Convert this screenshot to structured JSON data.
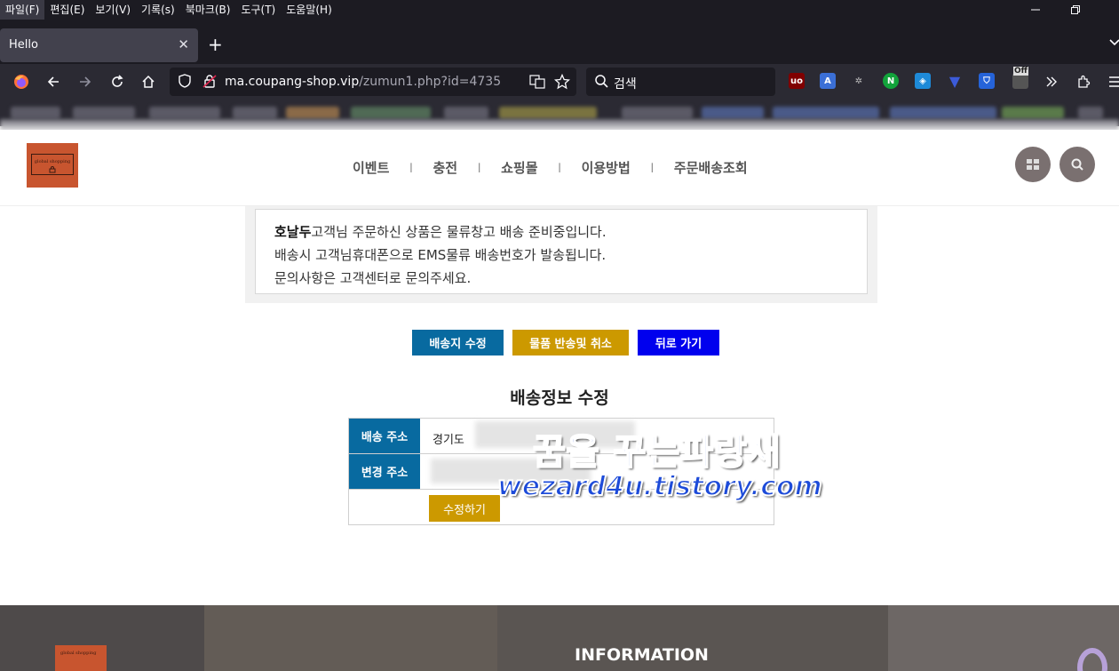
{
  "menubar": {
    "items": [
      "파일(F)",
      "편집(E)",
      "보기(V)",
      "기록(s)",
      "북마크(B)",
      "도구(T)",
      "도움말(H)"
    ]
  },
  "tab": {
    "title": "Hello",
    "close": "✕",
    "new_tab": "+"
  },
  "navbar": {
    "url_host": "ma.coupang-shop.vip",
    "url_path": "/zumun1.php?id=4735",
    "search_placeholder": "검색",
    "ext_off_badge": "Off"
  },
  "site": {
    "logo_text": "global shopping",
    "nav": [
      "이벤트",
      "충전",
      "쇼핑몰",
      "이용방법",
      "주문배송조회"
    ],
    "nav_separator": "ㅣ"
  },
  "notice": {
    "name": "호날두",
    "line1_rest": "고객님 주문하신 상품은 물류창고 배송 준비중입니다.",
    "line2": "배송시 고객님휴대폰으로 EMS물류 배송번호가 발송됩니다.",
    "line3": "문의사항은 고객센터로 문의주세요."
  },
  "buttons": {
    "edit_address": "배송지 수정",
    "return_cancel": "물품 반송및 취소",
    "back": "뒤로 가기"
  },
  "form": {
    "title": "배송정보 수정",
    "address_label": "배송 주소",
    "address_value": "경기도 ",
    "new_address_label": "변경 주소",
    "submit_label": "수정하기"
  },
  "watermark": {
    "line1": "꿈을 꾸는파랑새",
    "line2": "wezard4u.tistory.com"
  },
  "footer": {
    "heading": "INFORMATION",
    "logo_text": "global shopping"
  },
  "colors": {
    "primary_blue": "#086aa0",
    "gold": "#cc9900",
    "bright_blue": "#0000ee",
    "logo_orange": "#c8552f"
  }
}
